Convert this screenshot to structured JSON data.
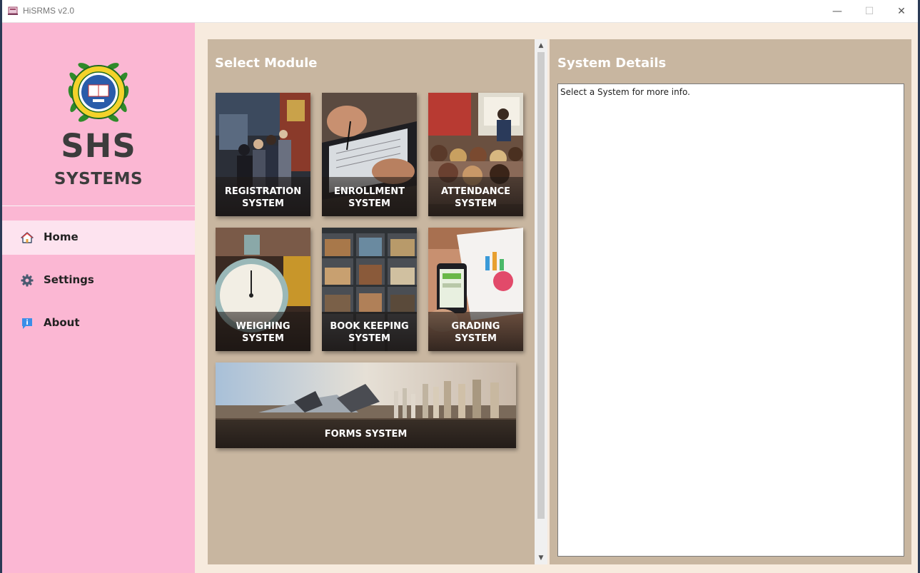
{
  "window": {
    "title": "HiSRMS v2.0",
    "controls": {
      "minimize": "—",
      "maximize": "☐",
      "close": "✕"
    }
  },
  "sidebar": {
    "brand_main": "SHS",
    "brand_sub": "SYSTEMS",
    "items": [
      {
        "label": "Home",
        "icon": "home-icon",
        "active": true
      },
      {
        "label": "Settings",
        "icon": "gear-icon",
        "active": false
      },
      {
        "label": "About",
        "icon": "info-icon",
        "active": false
      }
    ]
  },
  "modules": {
    "title": "Select Module",
    "tiles": [
      {
        "label": "REGISTRATION SYSTEM"
      },
      {
        "label": "ENROLLMENT SYSTEM"
      },
      {
        "label": "ATTENDANCE SYSTEM"
      },
      {
        "label": "WEIGHING SYSTEM"
      },
      {
        "label": "BOOK KEEPING SYSTEM"
      },
      {
        "label": "GRADING SYSTEM"
      },
      {
        "label": "FORMS SYSTEM"
      }
    ]
  },
  "details": {
    "title": "System Details",
    "text": "Select a System for more info."
  },
  "colors": {
    "sidebar_bg": "#fbb7d3",
    "active_item_bg": "#fde3ef",
    "panel_bg": "#c8b6a0",
    "content_bg": "#f7ebde"
  }
}
